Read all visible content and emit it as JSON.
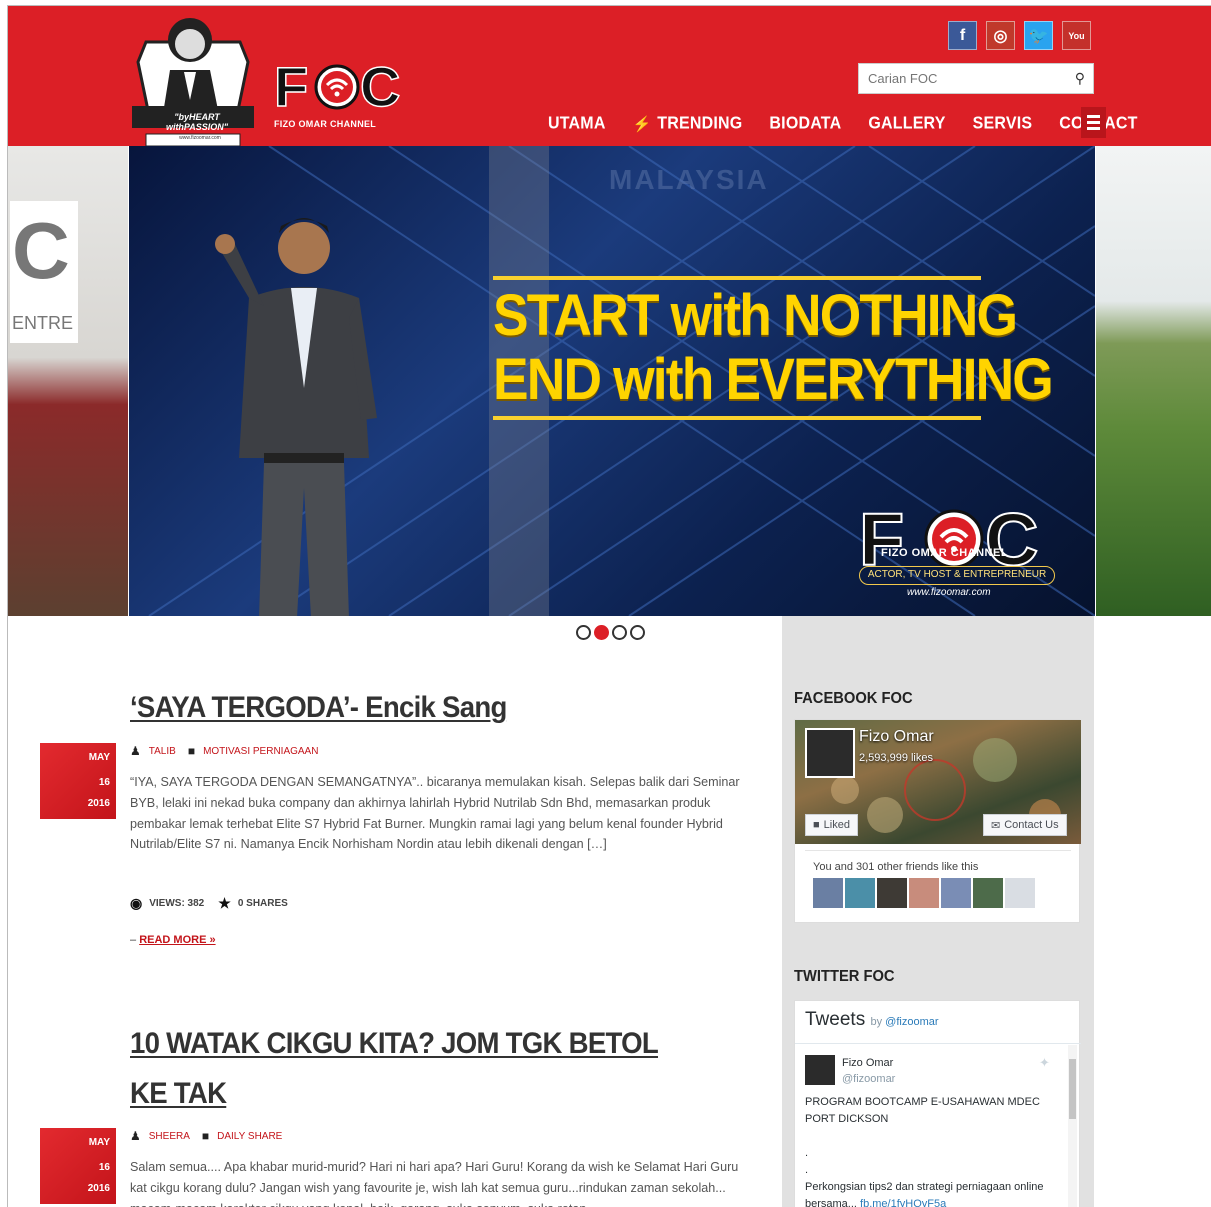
{
  "header": {
    "logo_tagline": "\"byHEART withPASSION\"",
    "logo_url_small": "www.fizoomar.com",
    "brand_letters": "FOC",
    "brand_name": "FIZO OMAR CHANNEL",
    "social": {
      "facebook": "f",
      "instagram": "◎",
      "twitter": "🐦",
      "youtube": "You"
    },
    "search": {
      "placeholder": "Carian FOC"
    },
    "nav": [
      {
        "label": "UTAMA"
      },
      {
        "label": "TRENDING",
        "icon": "bolt-icon"
      },
      {
        "label": "BIODATA"
      },
      {
        "label": "GALLERY"
      },
      {
        "label": "SERVIS"
      },
      {
        "label": "CONTACT"
      }
    ]
  },
  "slider": {
    "side_text": "ENTRE",
    "headline_1": "START with NOTHING",
    "headline_2": "END with EVERYTHING",
    "bg_text": "MALAYSIA",
    "brand": "FOC",
    "brand_name": "FIZO OMAR CHANNEL",
    "subtitle": "ACTOR, TV HOST & ENTREPRENEUR",
    "url": "www.fizoomar.com",
    "active_slide": 2,
    "slide_count": 4
  },
  "posts": [
    {
      "title": "‘SAYA TERGODA’- Encik Sang",
      "date": {
        "month": "MAY",
        "day": "16",
        "year": "2016"
      },
      "author": "TALIB",
      "category": "MOTIVASI PERNIAGAAN",
      "excerpt": "“IYA, SAYA TERGODA DENGAN SEMANGATNYA”.. bicaranya memulakan kisah. Selepas balik dari Seminar BYB, lelaki ini nekad buka company dan akhirnya lahirlah Hybrid Nutrilab Sdn Bhd, memasarkan produk pembakar lemak terhebat Elite S7 Hybrid Fat Burner.   Mungkin ramai lagi yang belum kenal founder Hybrid Nutrilab/Elite S7 ni. Namanya Encik Norhisham Nordin atau lebih dikenali dengan […]",
      "views": "VIEWS: 382",
      "shares": "0 SHARES",
      "read_more_prefix": "– ",
      "read_more": "READ MORE »"
    },
    {
      "title": "10 WATAK CIKGU KITA? JOM TGK BETOL KE TAK",
      "date": {
        "month": "MAY",
        "day": "16",
        "year": "2016"
      },
      "author": "SHEERA",
      "category": "DAILY SHARE",
      "excerpt": "Salam semua.... Apa khabar murid-murid? Hari ni hari apa? Hari Guru! Korang da wish ke Selamat Hari Guru kat cikgu korang dulu? Jangan wish yang favourite je, wish lah kat semua guru...rindukan zaman sekolah... macam-macam karakter cikgu yang kenal, baik, garang, suka senyum, suka rotan"
    }
  ],
  "sidebar": {
    "facebook_heading": "FACEBOOK FOC",
    "fb": {
      "name": "Fizo Omar",
      "likes": "2,593,999 likes",
      "liked_btn": "Liked",
      "contact_btn": "Contact Us",
      "friends_text": "You and 301 other friends like this"
    },
    "twitter_heading": "TWITTER FOC",
    "tw": {
      "title": "Tweets",
      "by": "by",
      "by_handle": "@fizoomar",
      "name": "Fizo Omar",
      "handle": "@fizoomar",
      "line1": "PROGRAM BOOTCAMP E-USAHAWAN MDEC PORT DICKSON",
      "dot1": ".",
      "dot2": ".",
      "line2": "Perkongsian tips2 dan strategi perniagaan online bersama...",
      "link": "fb.me/1fyHQyF5a"
    }
  },
  "colors": {
    "brand_red": "#dc1f26",
    "headline_yellow": "#ffd400",
    "sidebar_bg": "#e1e1e1"
  }
}
